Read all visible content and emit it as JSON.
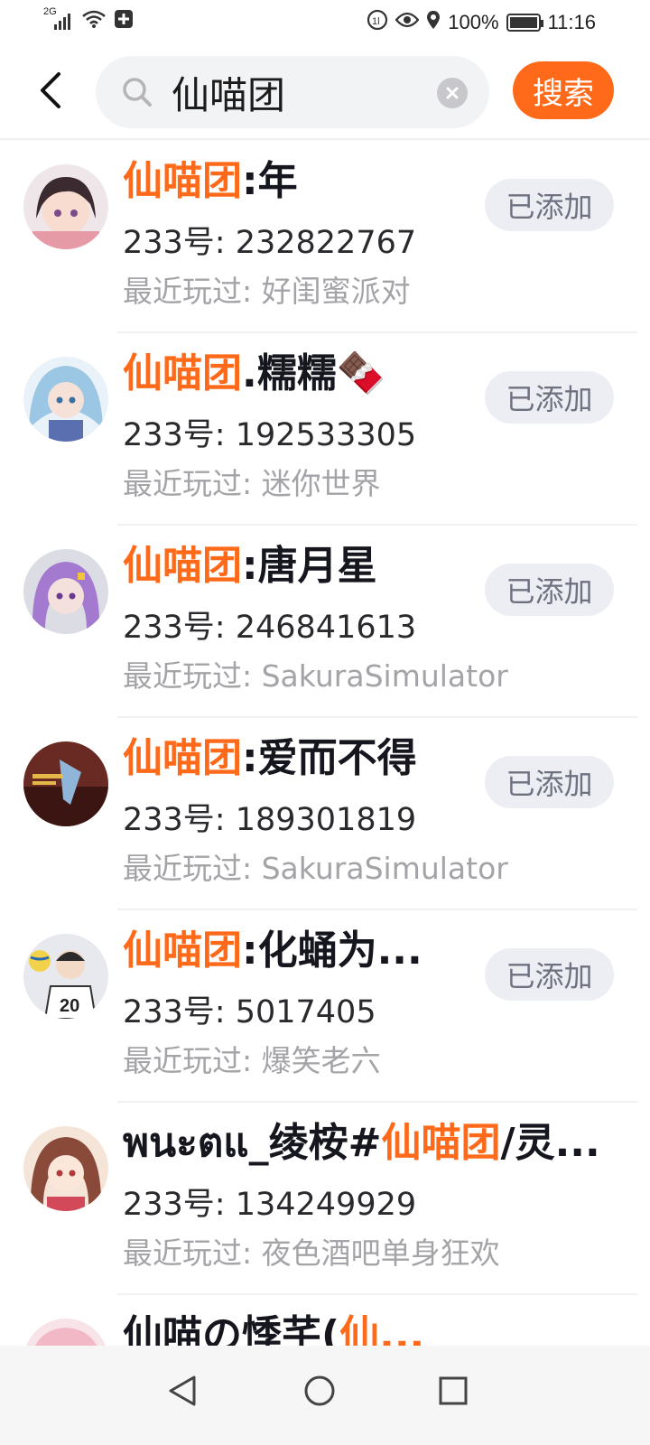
{
  "status_bar": {
    "network": "2G",
    "battery": "100%",
    "battery_level": 1.0,
    "time": "11:16"
  },
  "search": {
    "query": "仙喵团",
    "button_label": "搜索"
  },
  "colors": {
    "accent": "#ff6a1a",
    "added_bg": "#eceef4",
    "added_text": "#6e7280",
    "muted": "#a4a4a8"
  },
  "results": [
    {
      "name_prefix": "",
      "name_highlight": "仙喵团",
      "name_suffix": ":年",
      "uid": "233号: 232822767",
      "recent": "最近玩过: 好闺蜜派对",
      "button": "已添加",
      "avatar": "anime-girl-dark-hair"
    },
    {
      "name_prefix": "",
      "name_highlight": "仙喵团",
      "name_suffix": ".糯糯🍫",
      "uid": "233号: 192533305",
      "recent": "最近玩过: 迷你世界",
      "button": "已添加",
      "avatar": "anime-girl-blue-hair"
    },
    {
      "name_prefix": "",
      "name_highlight": "仙喵团",
      "name_suffix": ":唐月星",
      "uid": "233号: 246841613",
      "recent": "最近玩过: SakuraSimulator",
      "button": "已添加",
      "avatar": "anime-girl-purple-hair"
    },
    {
      "name_prefix": "",
      "name_highlight": "仙喵团",
      "name_suffix": ":爱而不得",
      "uid": "233号: 189301819",
      "recent": "最近玩过: SakuraSimulator",
      "button": "已添加",
      "avatar": "game-poster"
    },
    {
      "name_prefix": "",
      "name_highlight": "仙喵团",
      "name_suffix": ":化蛹为...",
      "uid": "233号: 5017405",
      "recent": "最近玩过: 爆笑老六",
      "button": "已添加",
      "avatar": "volleyball-player"
    },
    {
      "name_prefix": "พนะตแ_绫桉#",
      "name_highlight": "仙喵团",
      "name_suffix": "/灵...",
      "uid": "233号: 134249929",
      "recent": "最近玩过: 夜色酒吧单身狂欢",
      "button": "",
      "avatar": "anime-girl-brown-hair"
    },
    {
      "name_prefix": "仙喵の悸芊(",
      "name_highlight": "仙...",
      "name_suffix": "",
      "uid": "",
      "recent": "",
      "button": "",
      "avatar": "anime-girl-pink"
    }
  ]
}
